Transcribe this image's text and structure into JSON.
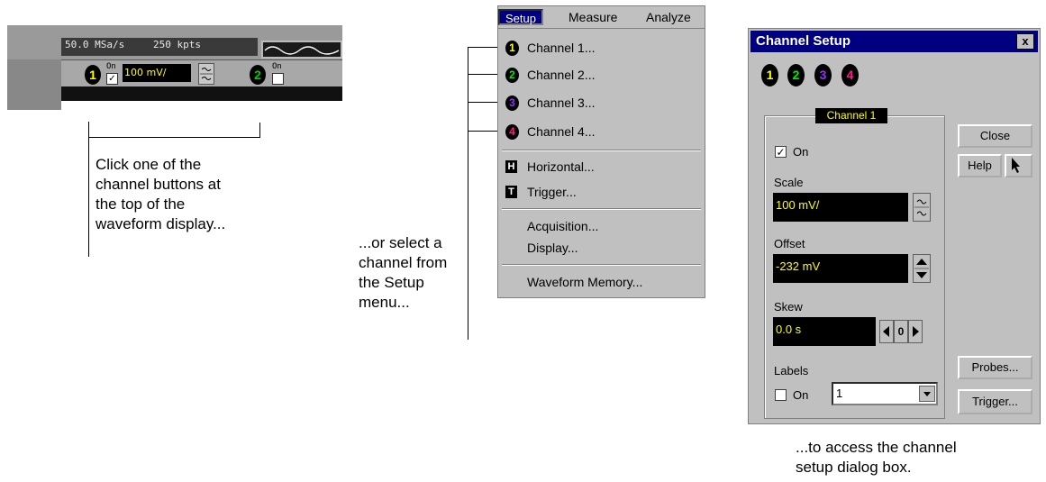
{
  "scope_strip": {
    "sample_rate": "50.0 MSa/s",
    "points": "250 kpts",
    "ch1": {
      "number": "1",
      "on_label": "On",
      "checked": "✓",
      "scale": "100 mV/",
      "color": "#ffff00"
    },
    "ch2": {
      "number": "2",
      "on_label": "On",
      "color": "#00c000"
    }
  },
  "captions": {
    "left": [
      "Click one of the",
      "channel buttons at",
      "the top of the",
      "waveform display..."
    ],
    "middle": [
      "...or select a",
      "channel from",
      "the Setup",
      "menu..."
    ],
    "right": [
      "...to access the channel",
      "setup dialog box."
    ]
  },
  "menu": {
    "bar": [
      "Setup",
      "Measure",
      "Analyze"
    ],
    "channels": [
      {
        "num": "1",
        "label": "Channel 1...",
        "color": "#ffff00"
      },
      {
        "num": "2",
        "label": "Channel 2...",
        "color": "#00e000"
      },
      {
        "num": "3",
        "label": "Channel 3...",
        "color": "#9a2cff"
      },
      {
        "num": "4",
        "label": "Channel 4...",
        "color": "#ff1a8c"
      }
    ],
    "horizontal": {
      "icon": "H",
      "label": "Horizontal..."
    },
    "trigger": {
      "icon": "T",
      "label": "Trigger..."
    },
    "acquisition": "Acquisition...",
    "display": "Display...",
    "waveform_memory": "Waveform Memory..."
  },
  "dialog": {
    "title": "Channel Setup",
    "close_x": "x",
    "channel_buttons": [
      {
        "num": "1",
        "color": "#ffff00"
      },
      {
        "num": "2",
        "color": "#00e000"
      },
      {
        "num": "3",
        "color": "#9a2cff"
      },
      {
        "num": "4",
        "color": "#ff1a8c"
      }
    ],
    "group_label": "Channel 1",
    "on_checkbox": {
      "label": "On",
      "checked": "✓"
    },
    "scale": {
      "label": "Scale",
      "value": "100 mV/"
    },
    "offset": {
      "label": "Offset",
      "value": "-232 mV"
    },
    "skew": {
      "label": "Skew",
      "value": "0.0 s",
      "zero": "0"
    },
    "labels": {
      "label": "Labels",
      "on_label": "On",
      "value": "1"
    },
    "buttons": {
      "close": "Close",
      "help": "Help",
      "whats_this": "?",
      "probes": "Probes...",
      "trigger": "Trigger..."
    }
  }
}
